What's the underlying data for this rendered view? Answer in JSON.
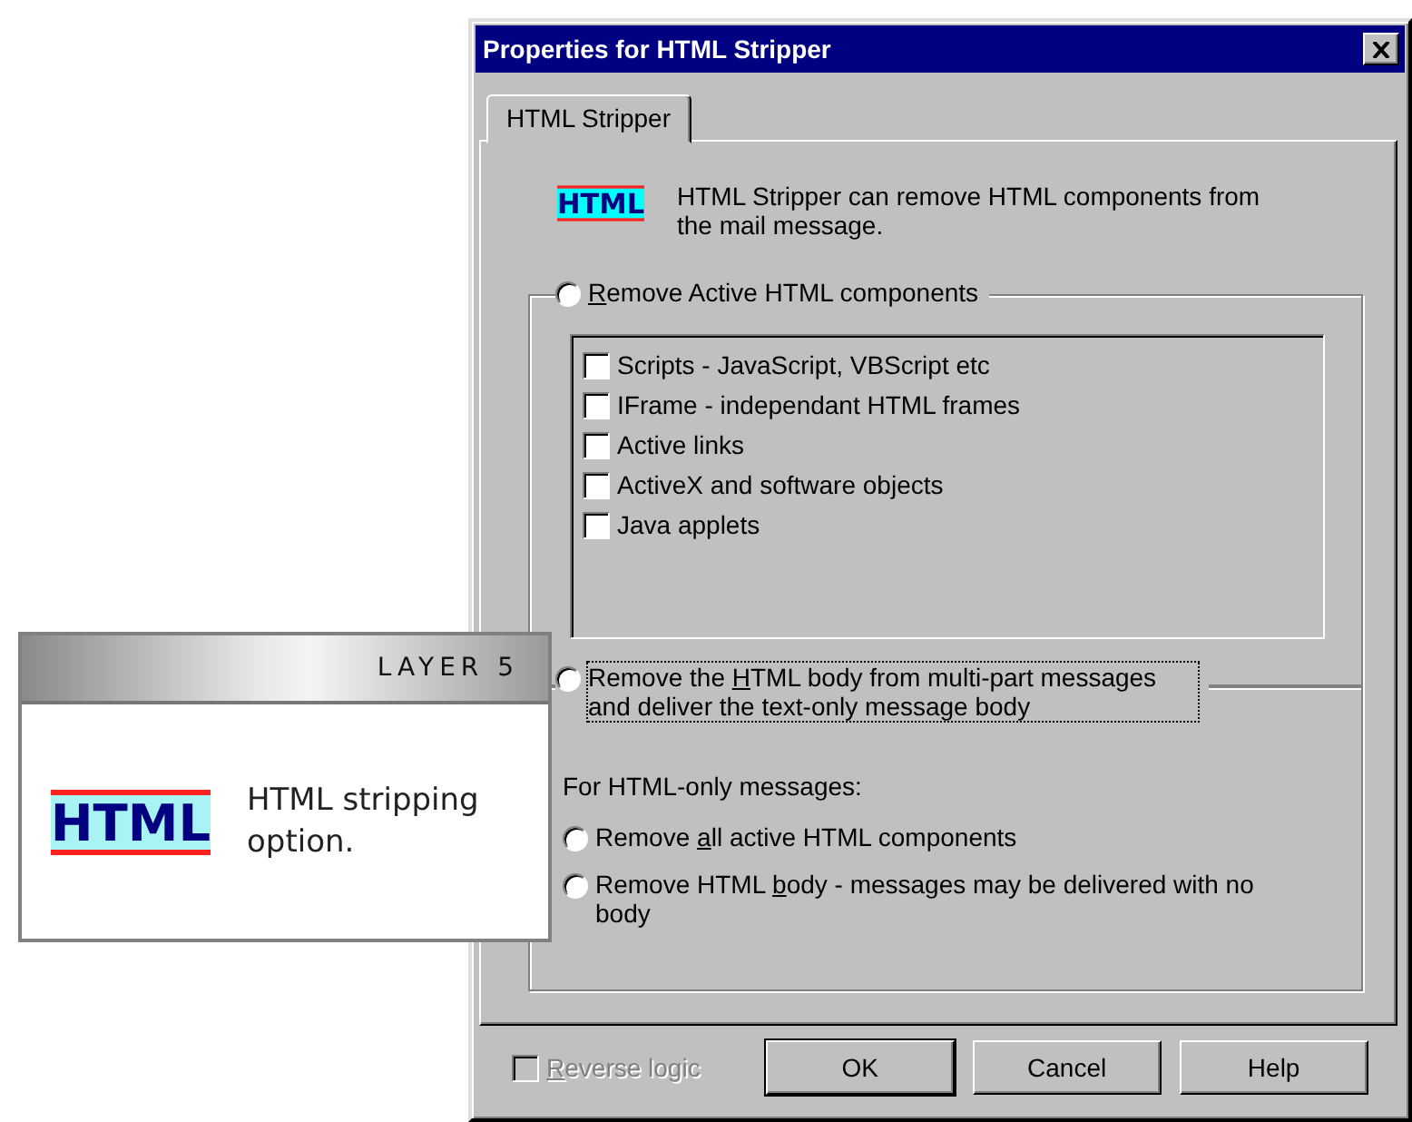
{
  "window": {
    "title": "Properties for HTML Stripper"
  },
  "tabs": [
    {
      "label": "HTML Stripper",
      "selected": true
    }
  ],
  "intro": {
    "text": "HTML Stripper can remove HTML components from the mail message.",
    "icon_label": "HTML"
  },
  "group_active": {
    "radio": {
      "accel": "R",
      "after": "emove Active HTML components",
      "selected": false
    },
    "options": [
      {
        "label": "Scripts - JavaScript, VBScript etc",
        "checked": false
      },
      {
        "label": "IFrame - independant HTML frames",
        "checked": false
      },
      {
        "label": "Active links",
        "checked": false
      },
      {
        "label": "ActiveX and software objects",
        "checked": false
      },
      {
        "label": "Java applets",
        "checked": false
      }
    ]
  },
  "group_body": {
    "radio": {
      "before": "Remove the ",
      "accel": "H",
      "after": "TML body from multi-part messages and deliver the text-only message body",
      "selected": false,
      "focused": true
    },
    "subheading": "For HTML-only messages:",
    "options": [
      {
        "before": "Remove ",
        "accel": "a",
        "after": "ll active HTML components",
        "selected": false
      },
      {
        "before": "Remove HTML ",
        "accel": "b",
        "after": "ody - messages may be delivered with no body",
        "selected": false
      }
    ]
  },
  "footer": {
    "reverse": {
      "accel": "R",
      "after": "everse logic",
      "checked": false,
      "disabled": true
    },
    "buttons": [
      {
        "label": "OK",
        "default": true
      },
      {
        "label": "Cancel",
        "default": false
      },
      {
        "label": "Help",
        "default": false
      }
    ]
  },
  "callout": {
    "heading": "LAYER 5",
    "icon_label": "HTML",
    "text": "HTML stripping option."
  }
}
